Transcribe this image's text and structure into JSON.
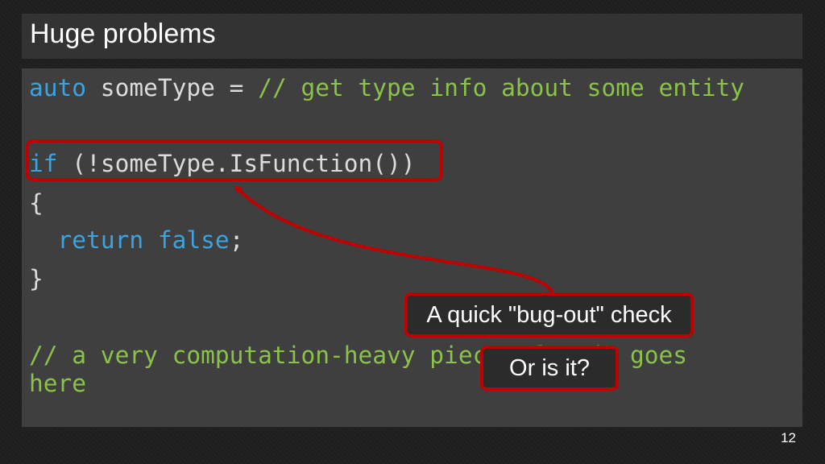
{
  "slide": {
    "title": "Huge problems",
    "page_number": "12"
  },
  "code": {
    "line1": {
      "keyword": "auto",
      "text": " someType = ",
      "comment": "// get type info about some entity"
    },
    "line2": {
      "keyword": "if",
      "text": " (!someType.IsFunction())"
    },
    "line3": "{",
    "line4": {
      "indent": "  ",
      "keyword1": "return",
      "space": " ",
      "keyword2": "false",
      "tail": ";"
    },
    "line5": "}",
    "line6": "// a very computation-heavy piece of code goes",
    "line7": "here"
  },
  "callouts": {
    "bug_out": "A quick \"bug-out\" check",
    "or_is_it": "Or is it?"
  },
  "colors": {
    "keyword": "#3ba3df",
    "comment": "#8ac24a",
    "highlight": "#c00000",
    "code_background": "#3f3f3f",
    "title_background": "#333333"
  }
}
